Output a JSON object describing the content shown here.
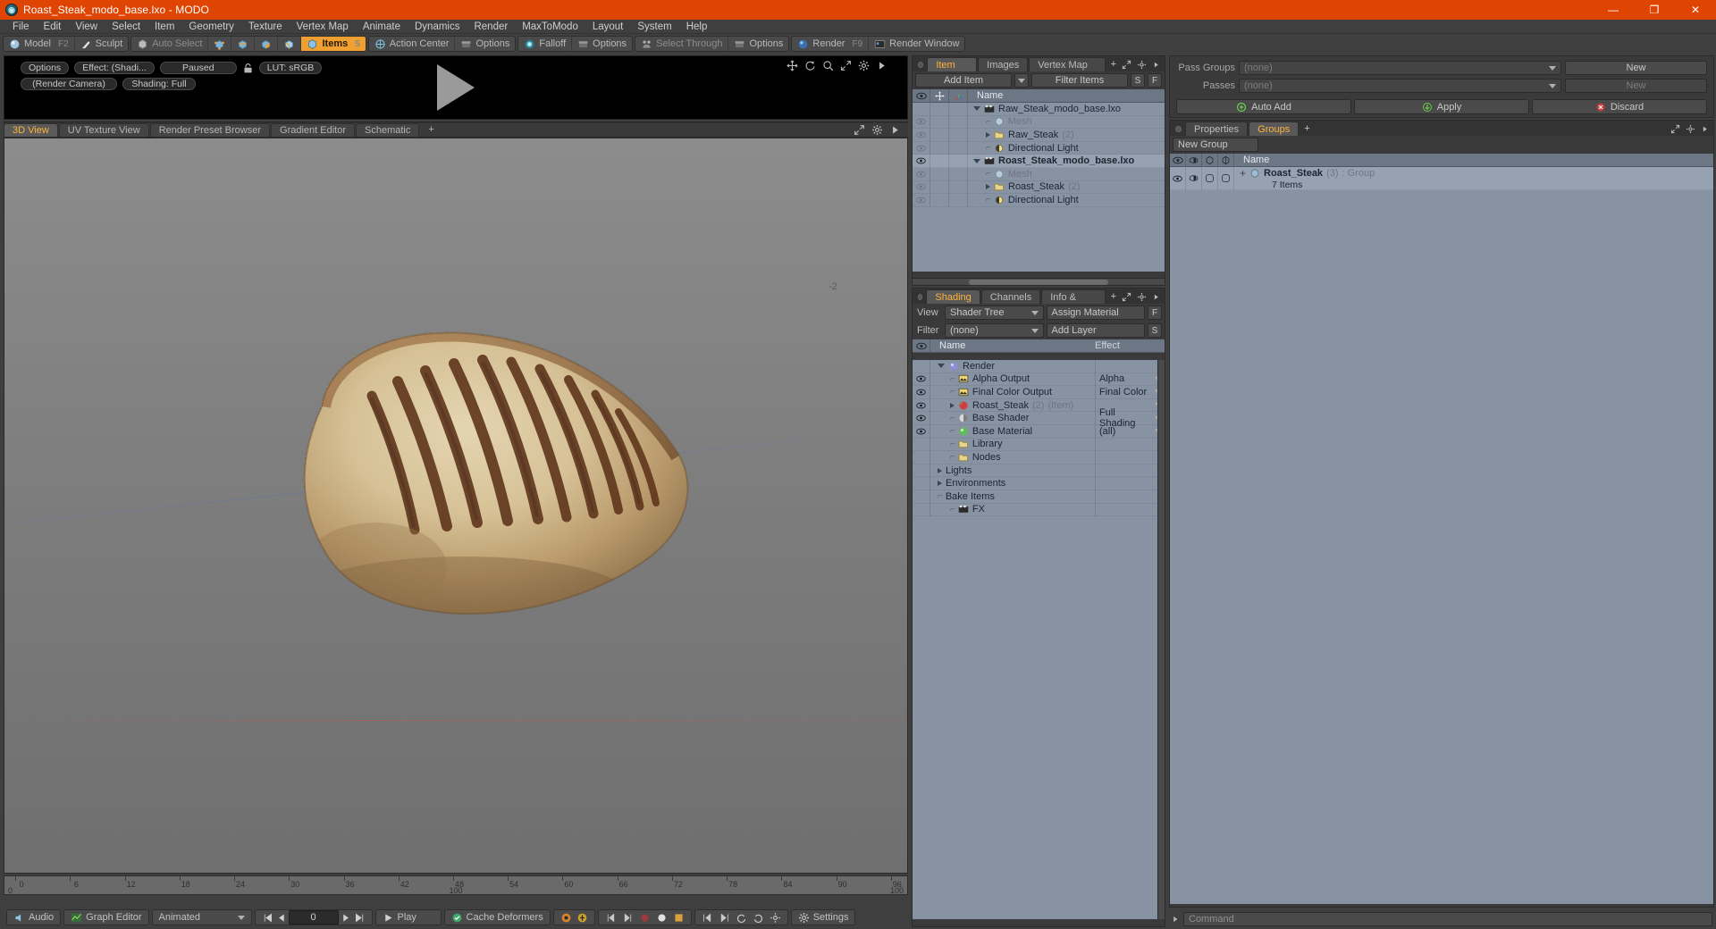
{
  "window": {
    "title": "Roast_Steak_modo_base.lxo - MODO",
    "controls": [
      "—",
      "❐",
      "✕"
    ]
  },
  "menubar": [
    "File",
    "Edit",
    "View",
    "Select",
    "Item",
    "Geometry",
    "Texture",
    "Vertex Map",
    "Animate",
    "Dynamics",
    "Render",
    "MaxToModo",
    "Layout",
    "System",
    "Help"
  ],
  "toolbar": {
    "mode": [
      {
        "label": "Model",
        "key": "F2",
        "icon": "sphere-icon",
        "state": "normal"
      },
      {
        "label": "Sculpt",
        "key": "",
        "icon": "brush-icon",
        "state": "normal"
      }
    ],
    "select": [
      {
        "label": "Auto Select",
        "key": "",
        "icon": "cube-icon",
        "state": "dim"
      },
      {
        "label": "",
        "key": "",
        "icon": "vertex-icon",
        "state": "normal"
      },
      {
        "label": "",
        "key": "",
        "icon": "edge-icon",
        "state": "normal"
      },
      {
        "label": "",
        "key": "",
        "icon": "polygon-icon",
        "state": "normal"
      },
      {
        "label": "",
        "key": "",
        "icon": "material-icon",
        "state": "normal"
      },
      {
        "label": "Items",
        "key": "5",
        "icon": "items-icon",
        "state": "active"
      }
    ],
    "center": [
      {
        "label": "Action Center",
        "key": "",
        "icon": "action-center-icon",
        "state": "normal"
      },
      {
        "label": "Options",
        "key": "",
        "icon": "options-icon",
        "state": "normal"
      }
    ],
    "falloff": [
      {
        "label": "Falloff",
        "key": "",
        "icon": "falloff-icon",
        "state": "normal"
      },
      {
        "label": "Options",
        "key": "",
        "icon": "options-icon",
        "state": "normal"
      }
    ],
    "through": [
      {
        "label": "Select Through",
        "key": "",
        "icon": "select-through-icon",
        "state": "dim"
      },
      {
        "label": "Options",
        "key": "",
        "icon": "options-icon",
        "state": "normal"
      }
    ],
    "render": [
      {
        "label": "Render",
        "key": "F9",
        "icon": "render-icon",
        "state": "normal"
      },
      {
        "label": "Render Window",
        "key": "",
        "icon": "render-window-icon",
        "state": "normal"
      }
    ]
  },
  "render_preview": {
    "row1": [
      "Options",
      "Effect: (Shadi...",
      "Paused"
    ],
    "lut": "LUT: sRGB",
    "row2": [
      "(Render Camera)",
      "Shading: Full"
    ],
    "icons": [
      "pan-icon",
      "rotate-icon",
      "zoom-icon",
      "fit-icon",
      "gear-icon",
      "arrow-icon"
    ],
    "footer_icons": [
      "fit-icon",
      "gear-icon",
      "arrow-icon"
    ]
  },
  "viewport": {
    "tabs": [
      "3D View",
      "UV Texture View",
      "Render Preset Browser",
      "Gradient Editor",
      "Schematic",
      "+"
    ],
    "active_tab": "3D View",
    "corner_label": "-2",
    "icons": [
      "fit-icon",
      "gear-icon",
      "arrow-icon"
    ]
  },
  "timeline": {
    "labels": [
      "0",
      "6",
      "12",
      "18",
      "24",
      "30",
      "36",
      "42",
      "48",
      "54",
      "60",
      "66",
      "72",
      "78",
      "84",
      "90",
      "96"
    ],
    "start": "0",
    "mid": "100",
    "end": "100"
  },
  "bottombar": {
    "audio": "Audio",
    "graph_editor": "Graph Editor",
    "animated": "Animated",
    "frame": "0",
    "play": "Play",
    "cache_deformers": "Cache Deformers",
    "settings": "Settings"
  },
  "item_list": {
    "tabs": [
      "Item List",
      "Images",
      "Vertex Map List",
      "+"
    ],
    "active_tab": "Item List",
    "add_item": "Add Item",
    "filter_items": "Filter Items",
    "btn_s": "S",
    "btn_f": "F",
    "columns": [
      "eye-icon",
      "move-icon",
      "axis-icon",
      "Name"
    ],
    "rows": [
      {
        "indent": 0,
        "twisty": "down",
        "icon": "scene-icon",
        "name": "Raw_Steak_modo_base.lxo",
        "count": "",
        "eye": false,
        "bold": false,
        "dim": false
      },
      {
        "indent": 1,
        "twisty": "leaf",
        "icon": "mesh-icon",
        "name": "Mesh",
        "count": "",
        "eye": true,
        "bold": false,
        "dim": true
      },
      {
        "indent": 1,
        "twisty": "right",
        "icon": "group-icon",
        "name": "Raw_Steak",
        "count": "(2)",
        "eye": true,
        "bold": false,
        "dim": false
      },
      {
        "indent": 1,
        "twisty": "leaf",
        "icon": "light-icon",
        "name": "Directional Light",
        "count": "",
        "eye": true,
        "bold": false,
        "dim": false
      },
      {
        "indent": 0,
        "twisty": "down",
        "icon": "scene-icon",
        "name": "Roast_Steak_modo_base.lxo",
        "count": "",
        "eye": true,
        "bold": true,
        "dim": false
      },
      {
        "indent": 1,
        "twisty": "leaf",
        "icon": "mesh-icon",
        "name": "Mesh",
        "count": "",
        "eye": true,
        "bold": false,
        "dim": true
      },
      {
        "indent": 1,
        "twisty": "right",
        "icon": "group-icon",
        "name": "Roast_Steak",
        "count": "(2)",
        "eye": true,
        "bold": false,
        "dim": false
      },
      {
        "indent": 1,
        "twisty": "leaf",
        "icon": "light-icon",
        "name": "Directional Light",
        "count": "",
        "eye": true,
        "bold": false,
        "dim": false
      }
    ]
  },
  "shading": {
    "tabs": [
      "Shading",
      "Channels",
      "Info & Statistics",
      "+"
    ],
    "active_tab": "Shading",
    "view_label": "View",
    "view_value": "Shader Tree",
    "assign_material": "Assign Material",
    "filter_label": "Filter",
    "filter_value": "(none)",
    "add_layer": "Add Layer",
    "btn_f": "F",
    "btn_s": "S",
    "columns": [
      "eye-icon",
      "Name",
      "Effect"
    ],
    "rows": [
      {
        "indent": 0,
        "twisty": "down",
        "icon": "render-globe-icon",
        "name": "Render",
        "count": "",
        "suffix": "",
        "effect": "",
        "effect_dropdown": false,
        "eye": false
      },
      {
        "indent": 1,
        "twisty": "leaf",
        "icon": "output-icon",
        "name": "Alpha Output",
        "count": "",
        "suffix": "",
        "effect": "Alpha",
        "effect_dropdown": true,
        "eye": true
      },
      {
        "indent": 1,
        "twisty": "leaf",
        "icon": "output-icon",
        "name": "Final Color Output",
        "count": "",
        "suffix": "",
        "effect": "Final Color",
        "effect_dropdown": true,
        "eye": true
      },
      {
        "indent": 1,
        "twisty": "right",
        "icon": "item-mat-icon",
        "name": "Roast_Steak",
        "count": "(2)",
        "suffix": "(Item)",
        "effect": "",
        "effect_dropdown": true,
        "eye": true
      },
      {
        "indent": 1,
        "twisty": "leaf",
        "icon": "shader-icon",
        "name": "Base Shader",
        "count": "",
        "suffix": "",
        "effect": "Full Shading",
        "effect_dropdown": true,
        "eye": true
      },
      {
        "indent": 1,
        "twisty": "leaf",
        "icon": "material-green-icon",
        "name": "Base Material",
        "count": "",
        "suffix": "",
        "effect": "(all)",
        "effect_dropdown": true,
        "eye": true
      },
      {
        "indent": 1,
        "twisty": "leaf",
        "icon": "folder-icon",
        "name": "Library",
        "count": "",
        "suffix": "",
        "effect": "",
        "effect_dropdown": false,
        "eye": false
      },
      {
        "indent": 1,
        "twisty": "leaf",
        "icon": "folder-icon",
        "name": "Nodes",
        "count": "",
        "suffix": "",
        "effect": "",
        "effect_dropdown": false,
        "eye": false
      },
      {
        "indent": 0,
        "twisty": "right",
        "icon": "none",
        "name": "Lights",
        "count": "",
        "suffix": "",
        "effect": "",
        "effect_dropdown": false,
        "eye": false
      },
      {
        "indent": 0,
        "twisty": "right",
        "icon": "none",
        "name": "Environments",
        "count": "",
        "suffix": "",
        "effect": "",
        "effect_dropdown": false,
        "eye": false
      },
      {
        "indent": 0,
        "twisty": "leaf",
        "icon": "none",
        "name": "Bake Items",
        "count": "",
        "suffix": "",
        "effect": "",
        "effect_dropdown": false,
        "eye": false
      },
      {
        "indent": 1,
        "twisty": "leaf",
        "icon": "fx-icon",
        "name": "FX",
        "count": "",
        "suffix": "",
        "effect": "",
        "effect_dropdown": false,
        "eye": false
      }
    ]
  },
  "passes": {
    "pass_groups_label": "Pass Groups",
    "pass_groups_value": "(none)",
    "pass_groups_new": "New",
    "passes_label": "Passes",
    "passes_value": "(none)",
    "passes_new": "New",
    "auto_add": "Auto Add",
    "apply": "Apply",
    "discard": "Discard"
  },
  "groups": {
    "tabs": [
      "Properties",
      "Groups",
      "+"
    ],
    "active_tab": "Groups",
    "new_group": "New Group",
    "columns": [
      "eye-icon",
      "shade-icon",
      "wire-icon",
      "solid-icon",
      "Name"
    ],
    "rows": [
      {
        "name": "Roast_Steak",
        "count": "(3)",
        "type": ": Group",
        "sub": "7 Items"
      }
    ]
  },
  "command": {
    "placeholder": "Command"
  },
  "colors": {
    "title_bar": "#e04403",
    "accent": "#ffb23c",
    "active_tool": "#f0a030",
    "panel_bg": "#3f3f3f",
    "tree_bg": "#8793a2",
    "tree_header": "#6c7684"
  }
}
